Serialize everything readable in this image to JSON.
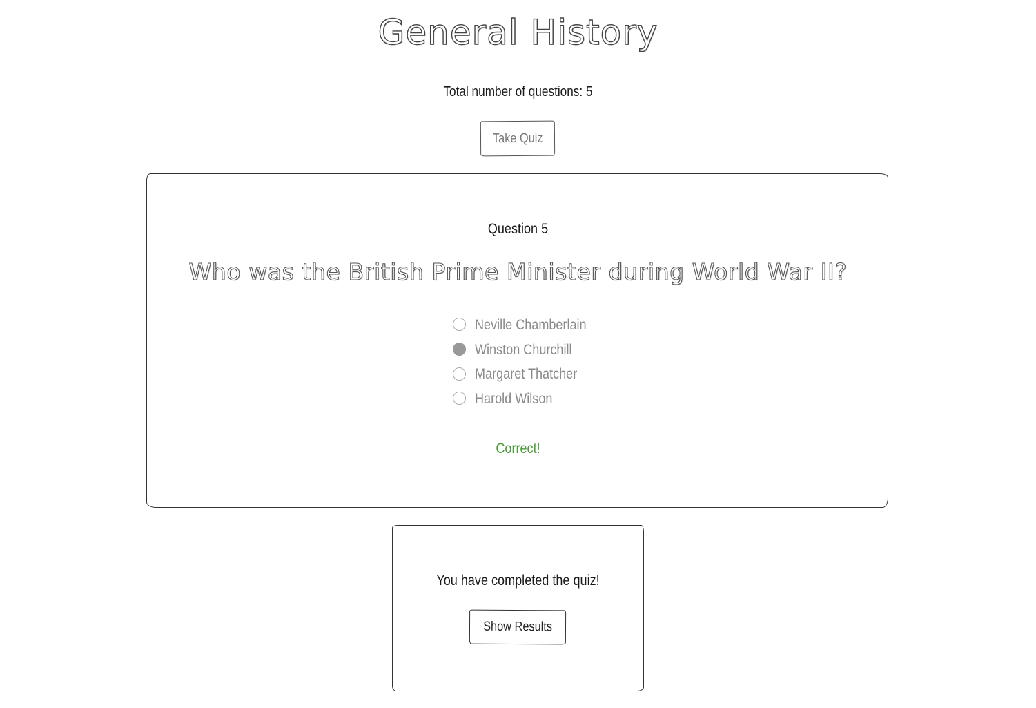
{
  "header": {
    "title": "General History",
    "total_questions_text": "Total number of questions: 5",
    "take_quiz_label": "Take Quiz"
  },
  "question": {
    "number_label": "Question 5",
    "text": "Who was the British Prime Minister during World War II?",
    "options": [
      {
        "label": "Neville Chamberlain",
        "checked": false
      },
      {
        "label": "Winston Churchill",
        "checked": true
      },
      {
        "label": "Margaret Thatcher",
        "checked": false
      },
      {
        "label": "Harold Wilson",
        "checked": false
      }
    ],
    "feedback": "Correct!",
    "feedback_color": "#4a9a3a"
  },
  "completion": {
    "message": "You have completed the quiz!",
    "show_results_label": "Show Results"
  }
}
